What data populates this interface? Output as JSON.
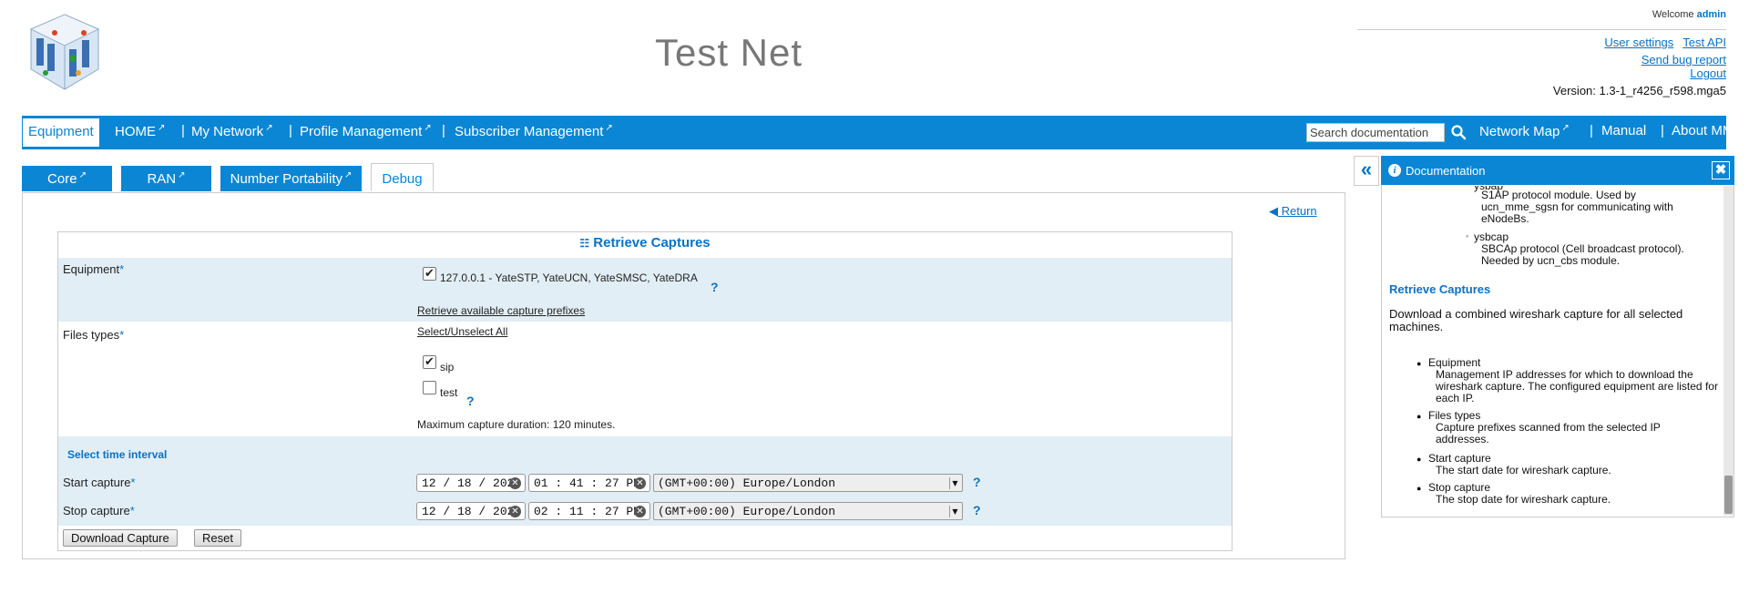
{
  "header": {
    "title": "Test Net",
    "welcome_prefix": "Welcome",
    "username": "admin",
    "links": {
      "user_settings": "User settings",
      "test_api": "Test API",
      "send_bug_report": "Send bug report",
      "logout": "Logout"
    },
    "version": "Version: 1.3-1_r4256_r598.mga5"
  },
  "navbar": {
    "equipment": "Equipment",
    "home": "HOME",
    "my_network": "My Network",
    "profile_management": "Profile Management",
    "subscriber_management": "Subscriber Management",
    "search_placeholder": "Search documentation",
    "network_map": "Network Map",
    "manual": "Manual",
    "about": "About MMI",
    "separator": "|"
  },
  "tabs": {
    "core": "Core",
    "ran": "RAN",
    "number_portability": "Number Portability",
    "debug": "Debug"
  },
  "main": {
    "return_label": "Return",
    "form_title": "Retrieve Captures",
    "equipment_label": "Equipment",
    "required_mark": "*",
    "equipment_value": "127.0.0.1 - YateSTP, YateUCN, YateSMSC, YateDRA",
    "equipment_checked": true,
    "retrieve_prefixes_link": "Retrieve available capture prefixes",
    "files_types_label": "Files types",
    "select_unselect_all": "Select/Unselect All",
    "file_types": [
      {
        "label": "sip",
        "checked": true
      },
      {
        "label": "test",
        "checked": false
      }
    ],
    "max_duration": "Maximum capture duration: 120 minutes.",
    "time_interval_heading": "Select time interval",
    "start_capture_label": "Start capture",
    "stop_capture_label": "Stop capture",
    "start_date": "12 / 18 / 2020",
    "start_time": "01 : 41 : 27  PM",
    "stop_date": "12 / 18 / 2020",
    "stop_time": "02 : 11 : 27  PM",
    "timezone": "(GMT+00:00) Europe/London",
    "help_mark": "?",
    "download_button": "Download Capture",
    "reset_button": "Reset"
  },
  "documentation": {
    "title": "Documentation",
    "partial_top": "ysbap",
    "s1ap_desc": "S1AP protocol module. Used by ucn_mme_sgsn for communicating with eNodeBs.",
    "ysbcap": "ysbcap",
    "ysbcap_desc": "SBCAp protocol (Cell broadcast protocol). Needed by ucn_cbs module.",
    "section_title": "Retrieve Captures",
    "section_desc": "Download a combined wireshark capture for all selected machines.",
    "items": [
      {
        "term": "Equipment",
        "desc": "Management IP addresses for which to download the wireshark capture. The configured equipment are listed for each IP."
      },
      {
        "term": "Files types",
        "desc": "Capture prefixes scanned from the selected IP addresses."
      },
      {
        "term": "Start capture",
        "desc": "The start date for wireshark capture."
      },
      {
        "term": "Stop capture",
        "desc": "The stop date for wireshark capture."
      }
    ]
  },
  "colors": {
    "brand_blue": "#0a86d4",
    "link_blue": "#0a72c4",
    "row_shade": "#e2eef6"
  }
}
